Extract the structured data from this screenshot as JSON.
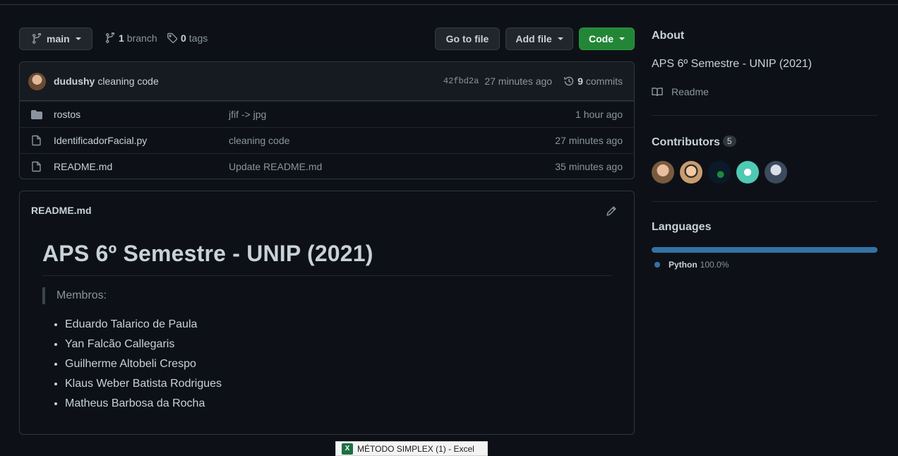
{
  "toolbar": {
    "branch": "main",
    "branch_count": "1",
    "branch_label": "branch",
    "tag_count": "0",
    "tag_label": "tags",
    "go_to_file": "Go to file",
    "add_file": "Add file",
    "code": "Code"
  },
  "latest_commit": {
    "author": "dudushy",
    "message": "cleaning code",
    "sha": "42fbd2a",
    "age": "27 minutes ago",
    "commit_count": "9",
    "commit_label": "commits"
  },
  "files": [
    {
      "name": "rostos",
      "type": "folder",
      "commit": "jfif -> jpg",
      "age": "1 hour ago"
    },
    {
      "name": "IdentificadorFacial.py",
      "type": "file",
      "commit": "cleaning code",
      "age": "27 minutes ago"
    },
    {
      "name": "README.md",
      "type": "file",
      "commit": "Update README.md",
      "age": "35 minutes ago"
    }
  ],
  "readme": {
    "filename": "README.md",
    "heading": "APS 6º Semestre - UNIP (2021)",
    "quote": "Membros:",
    "members": [
      "Eduardo Talarico de Paula",
      "Yan Falcão Callegaris",
      "Guilherme Altobeli Crespo",
      "Klaus Weber Batista Rodrigues",
      "Matheus Barbosa da Rocha"
    ]
  },
  "sidebar": {
    "about_title": "About",
    "about_desc": "APS 6º Semestre - UNIP (2021)",
    "readme_link": "Readme",
    "contributors_title": "Contributors",
    "contributors_count": "5",
    "languages_title": "Languages",
    "languages": [
      {
        "name": "Python",
        "percent": "100.0%",
        "fraction": 1.0,
        "color": "#3572A5"
      }
    ]
  },
  "taskbar": {
    "preview_title": "MÉTODO SIMPLEX (1) - Excel"
  },
  "colors": {
    "background": "#0d1117",
    "border": "#30363d",
    "primary_button": "#238636",
    "muted_text": "#8b949e"
  }
}
